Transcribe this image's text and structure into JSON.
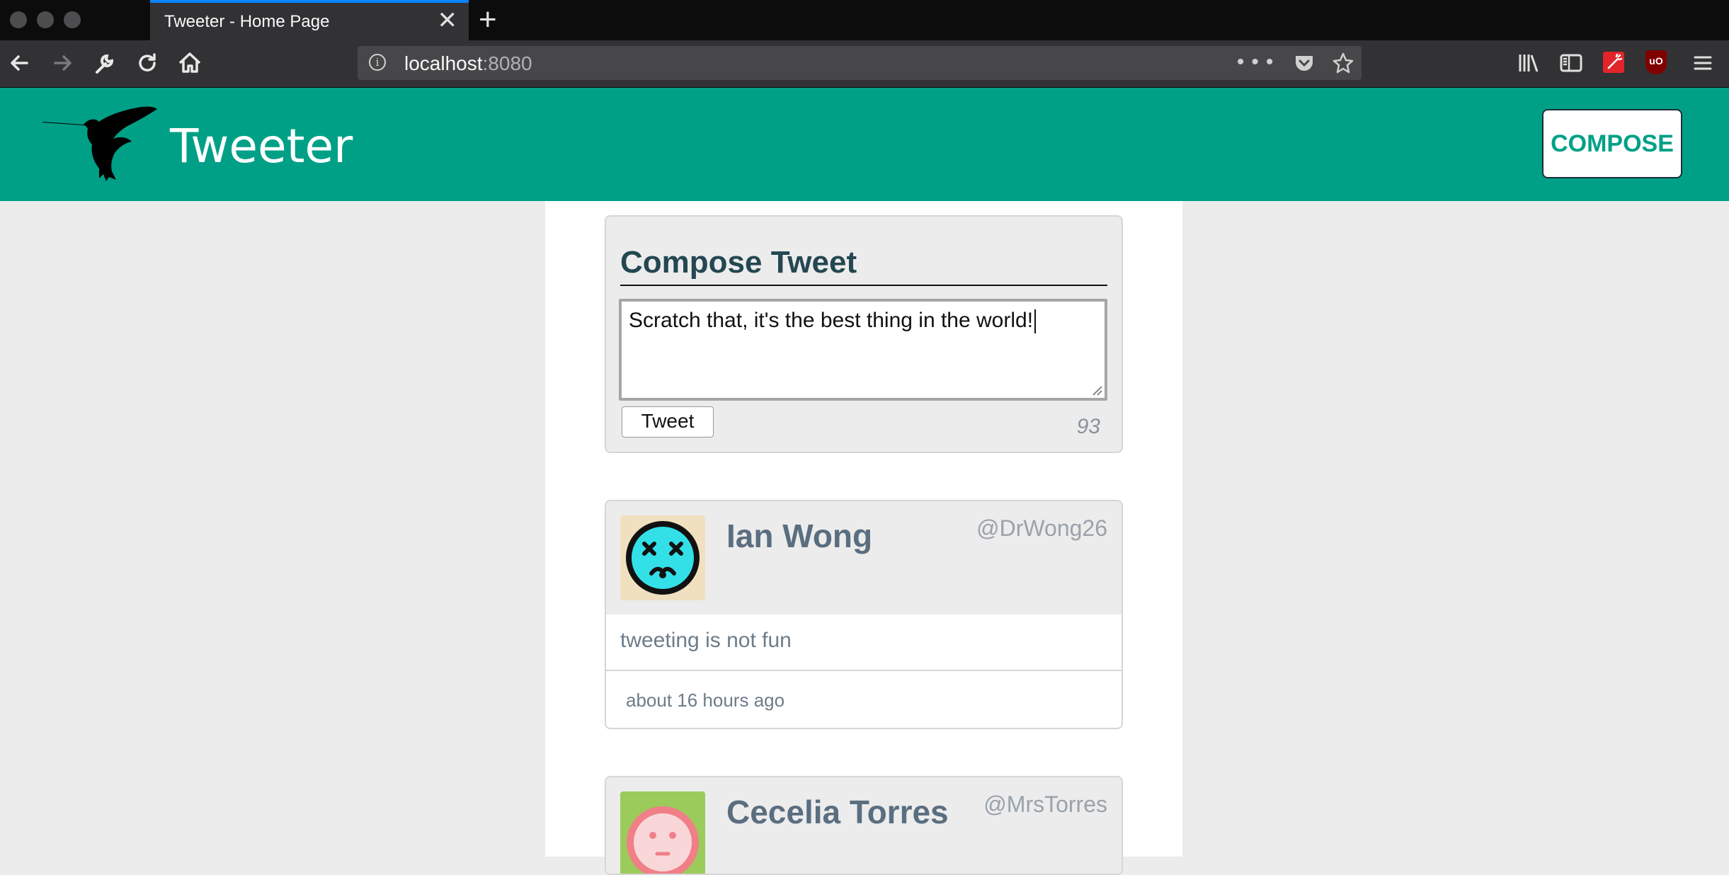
{
  "browser": {
    "tab_title": "Tweeter - Home Page",
    "tab_close": "✕",
    "new_tab": "+",
    "url_host": "localhost",
    "url_port": ":8080",
    "url_actions": "••• ",
    "extension_ublock": "uO"
  },
  "header": {
    "site_title": "Tweeter",
    "compose_label": "COMPOSE",
    "brand_color": "#00a087"
  },
  "compose": {
    "title": "Compose Tweet",
    "text": "Scratch that, it's the best thing in the world!",
    "tweet_button": "Tweet",
    "counter": "93"
  },
  "tweets": [
    {
      "name": "Ian Wong",
      "handle": "@DrWong26",
      "text": "tweeting is not fun",
      "time": "about 16 hours ago",
      "avatar_bg": "#f0e0bf",
      "avatar_face": "#33e0e8"
    },
    {
      "name": "Cecelia Torres",
      "handle": "@MrsTorres",
      "avatar_bg": "#9bcb5a",
      "avatar_face": "#f07f88"
    }
  ]
}
